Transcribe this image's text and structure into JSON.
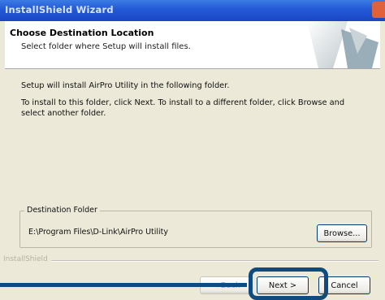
{
  "window": {
    "title": "InstallShield Wizard"
  },
  "header": {
    "title": "Choose Destination Location",
    "subtitle": "Select folder where Setup will install files."
  },
  "body": {
    "line1": "Setup will install AirPro Utility in the following folder.",
    "line2": "To install to this folder, click Next. To install to a different folder, click Browse and select another folder."
  },
  "destination": {
    "group_label": "Destination Folder",
    "path": "E:\\Program Files\\D-Link\\AirPro Utility",
    "browse_label": "Browse..."
  },
  "footer": {
    "brand": "InstallShield",
    "back_label": "< Back",
    "next_label": "Next >",
    "cancel_label": "Cancel"
  },
  "colors": {
    "titlebar": "#2458d6",
    "callout": "#0f4a80",
    "dialog_bg": "#ece9d8"
  }
}
